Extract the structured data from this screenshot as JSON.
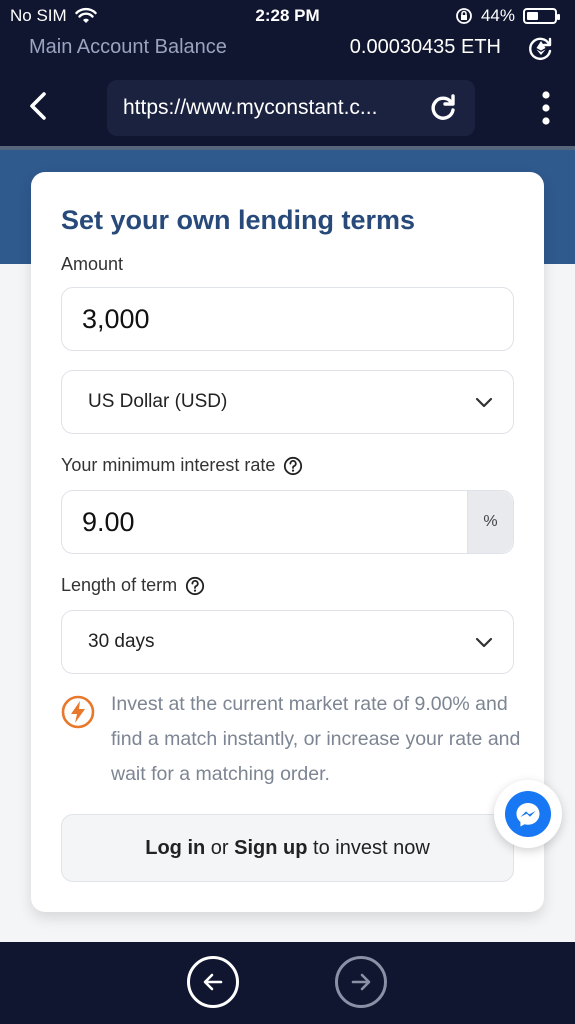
{
  "status_bar": {
    "carrier": "No SIM",
    "time": "2:28 PM",
    "battery": "44%",
    "battery_level": 0.44
  },
  "account": {
    "label": "Main Account Balance",
    "balance": "0.00030435 ETH"
  },
  "browser": {
    "url": "https://www.myconstant.c..."
  },
  "form": {
    "title": "Set your own lending terms",
    "amount_label": "Amount",
    "amount_value": "3,000",
    "currency_value": "US Dollar (USD)",
    "rate_label": "Your minimum interest rate",
    "rate_value": "9.00",
    "rate_unit": "%",
    "term_label": "Length of term",
    "term_value": "30 days",
    "info_text": "Invest at the current market rate of 9.00% and find a match instantly, or increase your rate and wait for a matching order.",
    "cta": {
      "login": "Log in",
      "or": "or",
      "signup": "Sign up",
      "suffix": "to invest now"
    }
  },
  "colors": {
    "header_bg": "#10162f",
    "band": "#2f5a8e",
    "title": "#284a7a",
    "accent_orange": "#e8782c",
    "messenger": "#1877f2"
  },
  "icons": [
    "wifi-icon",
    "orientation-lock-icon",
    "battery-icon",
    "ethereum-switch-icon",
    "back-icon",
    "reload-icon",
    "more-options-icon",
    "help-icon",
    "chevron-down-icon",
    "lightning-icon",
    "messenger-icon",
    "arrow-left-icon",
    "arrow-right-icon"
  ]
}
